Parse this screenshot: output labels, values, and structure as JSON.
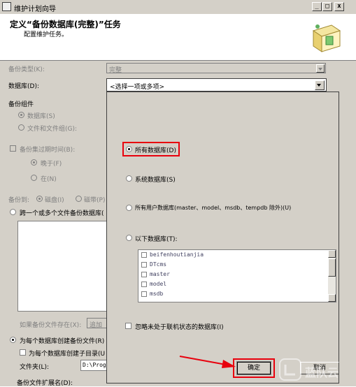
{
  "window": {
    "title": "维护计划向导",
    "min": "_",
    "max": "□",
    "close": "x"
  },
  "header": {
    "title": "定义“备份数据库(完整)”任务",
    "subtitle": "配置维护任务。"
  },
  "form": {
    "backup_type_label": "备份类型(K):",
    "backup_type_value": "完整",
    "database_label": "数据库(D):",
    "database_value": "<选择一项或多项>",
    "backup_component_label": "备份组件",
    "component_database": "数据库(S)",
    "component_files": "文件和文件组(G):",
    "expire_label": "备份集过期时间(B):",
    "expire_after": "晚于(F)",
    "expire_on": "在(N)",
    "backup_to_label": "备份到:",
    "backup_to_disk": "磁盘(I)",
    "backup_to_tape": "磁带(P)",
    "span_files_label": "跨一个或多个文件备份数据库(",
    "if_exists_label": "如果备份文件存在(X):",
    "if_exists_value": "追加",
    "create_per_db_label": "为每个数据库创建备份文件(R)",
    "create_subdir_label": "为每个数据库创建子目录(U",
    "folder_label": "文件夹(L):",
    "folder_value": "D:\\Progr",
    "ext_label": "备份文件扩展名(D):"
  },
  "popup": {
    "all_dbs": "所有数据库(D)",
    "system_dbs": "系统数据库(S)",
    "user_dbs": "所有用户数据库(master、model、msdb、tempdb 除外)(U)",
    "these_dbs": "以下数据库(T):",
    "db_list": [
      "beifenhoutianjia",
      "DTcms",
      "master",
      "model",
      "msdb"
    ],
    "ignore_offline": "忽略未处于联机状态的数据库(I)",
    "ok": "确定",
    "cancel": "取消"
  },
  "watermark": "蓝队云",
  "colors": {
    "highlight": "#e8000d",
    "dialog_bg": "#d4d0c8"
  }
}
